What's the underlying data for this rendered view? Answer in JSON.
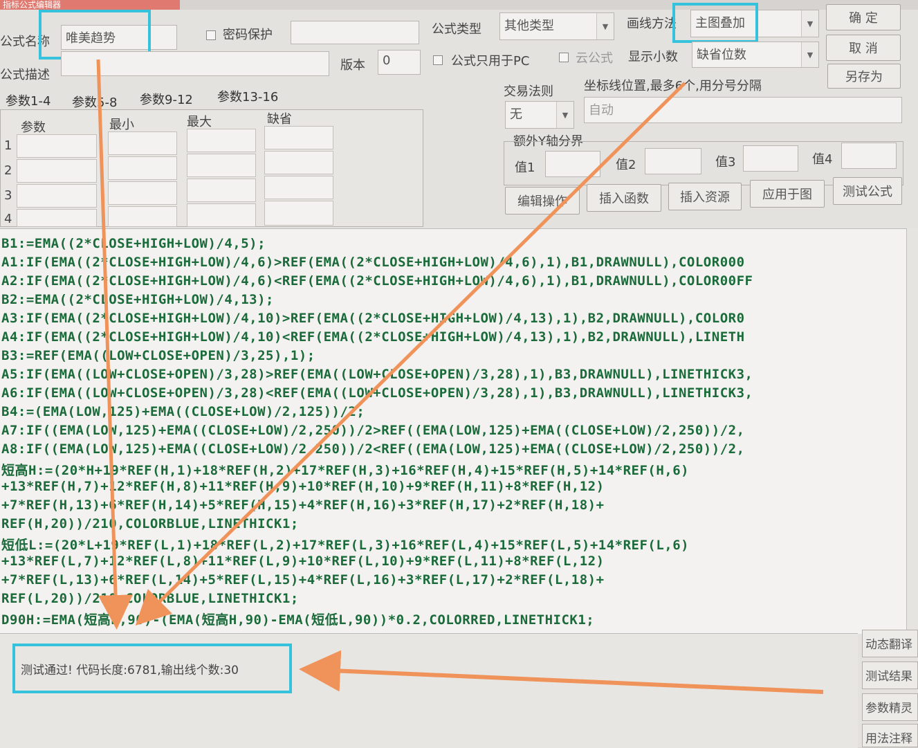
{
  "window": {
    "title": "指标公式编辑器"
  },
  "form": {
    "name_label": "公式名称",
    "name_value": "唯美趋势",
    "password_label": "密码保护",
    "formula_type_label": "公式类型",
    "formula_type_value": "其他类型",
    "draw_method_label": "画线方法",
    "draw_method_value": "主图叠加",
    "desc_label": "公式描述",
    "version_label": "版本",
    "version_value": "0",
    "pc_only_label": "公式只用于PC",
    "cloud_label": "云公式",
    "decimals_label": "显示小数",
    "decimals_value": "缺省位数"
  },
  "buttons": {
    "ok": "确 定",
    "cancel": "取 消",
    "save_as": "另存为",
    "edit": "编辑操作",
    "insert_func": "插入函数",
    "insert_res": "插入资源",
    "apply": "应用于图",
    "test": "测试公式"
  },
  "param_tabs": [
    "参数1-4",
    "参数5-8",
    "参数9-12",
    "参数13-16"
  ],
  "param_table": {
    "headers": [
      "参数",
      "最小",
      "最大",
      "缺省"
    ],
    "row_numbers": [
      "1",
      "2",
      "3",
      "4"
    ]
  },
  "trade_rule": {
    "label": "交易法则",
    "value": "无"
  },
  "axis": {
    "label": "坐标线位置,最多6个,用分号分隔",
    "value": "自动"
  },
  "extra_y": {
    "label": "额外Y轴分界",
    "v1": "值1",
    "v2": "值2",
    "v3": "值3",
    "v4": "值4"
  },
  "code_lines": [
    "B1:=EMA((2*CLOSE+HIGH+LOW)/4,5);",
    "A1:IF(EMA((2*CLOSE+HIGH+LOW)/4,6)>REF(EMA((2*CLOSE+HIGH+LOW)/4,6),1),B1,DRAWNULL),COLOR000",
    "A2:IF(EMA((2*CLOSE+HIGH+LOW)/4,6)<REF(EMA((2*CLOSE+HIGH+LOW)/4,6),1),B1,DRAWNULL),COLOR00FF",
    "B2:=EMA((2*CLOSE+HIGH+LOW)/4,13);",
    "A3:IF(EMA((2*CLOSE+HIGH+LOW)/4,10)>REF(EMA((2*CLOSE+HIGH+LOW)/4,13),1),B2,DRAWNULL),COLOR0",
    "A4:IF(EMA((2*CLOSE+HIGH+LOW)/4,10)<REF(EMA((2*CLOSE+HIGH+LOW)/4,13),1),B2,DRAWNULL),LINETH",
    "B3:=REF(EMA((LOW+CLOSE+OPEN)/3,25),1);",
    "A5:IF(EMA((LOW+CLOSE+OPEN)/3,28)>REF(EMA((LOW+CLOSE+OPEN)/3,28),1),B3,DRAWNULL),LINETHICK3,",
    "A6:IF(EMA((LOW+CLOSE+OPEN)/3,28)<REF(EMA((LOW+CLOSE+OPEN)/3,28),1),B3,DRAWNULL),LINETHICK3,",
    "B4:=(EMA(LOW,125)+EMA((CLOSE+LOW)/2,125))/2;",
    "A7:IF((EMA(LOW,125)+EMA((CLOSE+LOW)/2,250))/2>REF((EMA(LOW,125)+EMA((CLOSE+LOW)/2,250))/2,",
    "A8:IF((EMA(LOW,125)+EMA((CLOSE+LOW)/2,250))/2<REF((EMA(LOW,125)+EMA((CLOSE+LOW)/2,250))/2,",
    "短高H:=(20*H+19*REF(H,1)+18*REF(H,2)+17*REF(H,3)+16*REF(H,4)+15*REF(H,5)+14*REF(H,6)",
    "+13*REF(H,7)+12*REF(H,8)+11*REF(H,9)+10*REF(H,10)+9*REF(H,11)+8*REF(H,12)",
    "+7*REF(H,13)+6*REF(H,14)+5*REF(H,15)+4*REF(H,16)+3*REF(H,17)+2*REF(H,18)+",
    "REF(H,20))/210,COLORBLUE,LINETHICK1;",
    "短低L:=(20*L+19*REF(L,1)+18*REF(L,2)+17*REF(L,3)+16*REF(L,4)+15*REF(L,5)+14*REF(L,6)",
    "+13*REF(L,7)+12*REF(L,8)+11*REF(L,9)+10*REF(L,10)+9*REF(L,11)+8*REF(L,12)",
    "+7*REF(L,13)+6*REF(L,14)+5*REF(L,15)+4*REF(L,16)+3*REF(L,17)+2*REF(L,18)+",
    "REF(L,20))/210,COLORBLUE,LINETHICK1;",
    "D90H:=EMA(短高H,90)-(EMA(短高H,90)-EMA(短低L,90))*0.2,COLORRED,LINETHICK1;"
  ],
  "status": {
    "message": "测试通过! 代码长度:6781,输出线个数:30"
  },
  "side_buttons": [
    "动态翻译",
    "测试结果",
    "参数精灵",
    "用法注释"
  ],
  "colors": {
    "highlight": "#35c2dd",
    "arrow": "#f0935a",
    "code_text": "#1a6a3a"
  }
}
